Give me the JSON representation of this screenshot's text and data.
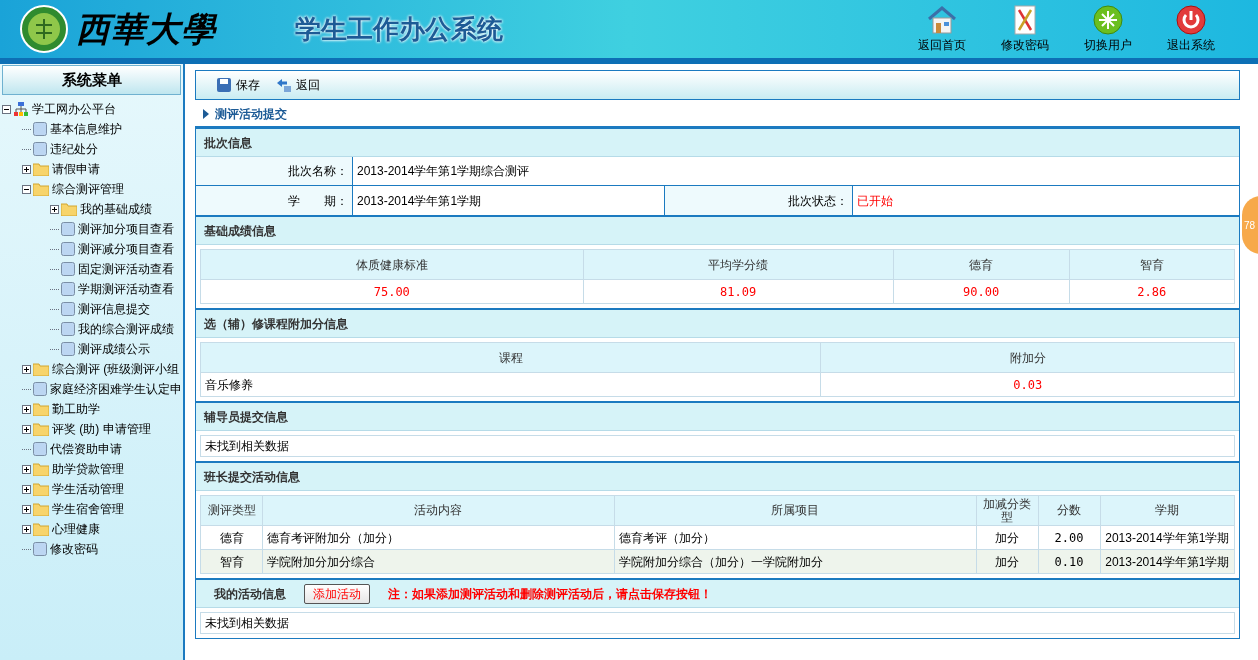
{
  "header": {
    "logo_text": "西華大學",
    "system_title": "学生工作办公系统",
    "nav": [
      {
        "label": "返回首页",
        "kind": "home"
      },
      {
        "label": "修改密码",
        "kind": "password"
      },
      {
        "label": "切换用户",
        "kind": "switch"
      },
      {
        "label": "退出系统",
        "kind": "exit"
      }
    ]
  },
  "sidebar": {
    "title": "系统菜单",
    "tree": [
      {
        "label": "学工网办公平台",
        "kind": "root",
        "expanded": true,
        "children": [
          {
            "label": "基本信息维护",
            "kind": "page"
          },
          {
            "label": "违纪处分",
            "kind": "page"
          },
          {
            "label": "请假申请",
            "kind": "folder",
            "expanded": false
          },
          {
            "label": "综合测评管理",
            "kind": "folder",
            "expanded": true,
            "children": [
              {
                "label": "我的基础成绩",
                "kind": "folder",
                "expanded": false
              },
              {
                "label": "测评加分项目查看",
                "kind": "page"
              },
              {
                "label": "测评减分项目查看",
                "kind": "page"
              },
              {
                "label": "固定测评活动查看",
                "kind": "page"
              },
              {
                "label": "学期测评活动查看",
                "kind": "page"
              },
              {
                "label": "测评信息提交",
                "kind": "page"
              },
              {
                "label": "我的综合测评成绩",
                "kind": "page"
              },
              {
                "label": "测评成绩公示",
                "kind": "page"
              }
            ]
          },
          {
            "label": "综合测评 (班级测评小组",
            "kind": "folder",
            "expanded": false
          },
          {
            "label": "家庭经济困难学生认定申",
            "kind": "page"
          },
          {
            "label": "勤工助学",
            "kind": "folder",
            "expanded": false
          },
          {
            "label": "评奖 (助) 申请管理",
            "kind": "folder",
            "expanded": false
          },
          {
            "label": "代偿资助申请",
            "kind": "page"
          },
          {
            "label": "助学贷款管理",
            "kind": "folder",
            "expanded": false
          },
          {
            "label": "学生活动管理",
            "kind": "folder",
            "expanded": false
          },
          {
            "label": "学生宿舍管理",
            "kind": "folder",
            "expanded": false
          },
          {
            "label": "心理健康",
            "kind": "folder",
            "expanded": false
          },
          {
            "label": "修改密码",
            "kind": "page"
          }
        ]
      }
    ]
  },
  "toolbar": [
    {
      "label": "保存",
      "kind": "save"
    },
    {
      "label": "返回",
      "kind": "back"
    }
  ],
  "breadcrumb": "测评活动提交",
  "batch": {
    "title": "批次信息",
    "name_label": "批次名称：",
    "name_value": "2013-2014学年第1学期综合测评",
    "term_label": "学　　期：",
    "term_value": "2013-2014学年第1学期",
    "status_label": "批次状态：",
    "status_value": "已开始"
  },
  "scores": {
    "title": "基础成绩信息",
    "columns": [
      "体质健康标准",
      "平均学分绩",
      "德育",
      "智育"
    ],
    "values": [
      "75.00",
      "81.09",
      "90.00",
      "2.86"
    ]
  },
  "courses": {
    "title": "选（辅）修课程附加分信息",
    "columns": [
      "课程",
      "附加分"
    ],
    "rows": [
      {
        "course": "音乐修养",
        "points": "0.03"
      }
    ]
  },
  "counselor": {
    "title": "辅导员提交信息",
    "empty": "未找到相关数据"
  },
  "monitor": {
    "title": "班长提交活动信息",
    "columns": [
      "测评类型",
      "活动内容",
      "所属项目",
      "加减分类型",
      "分数",
      "学期"
    ],
    "rows": [
      [
        "德育",
        "德育考评附加分（加分）",
        "德育考评（加分）",
        "加分",
        "2.00",
        "2013-2014学年第1学期"
      ],
      [
        "智育",
        "学院附加分加分综合",
        "学院附加分综合（加分）一学院附加分",
        "加分",
        "0.10",
        "2013-2014学年第1学期"
      ]
    ]
  },
  "my_activities": {
    "title": "我的活动信息",
    "add_button": "添加活动",
    "note": "注：如果添加测评活动和删除测评活动后，请点击保存按钮！",
    "empty": "未找到相关数据"
  },
  "floating_badge": "78"
}
